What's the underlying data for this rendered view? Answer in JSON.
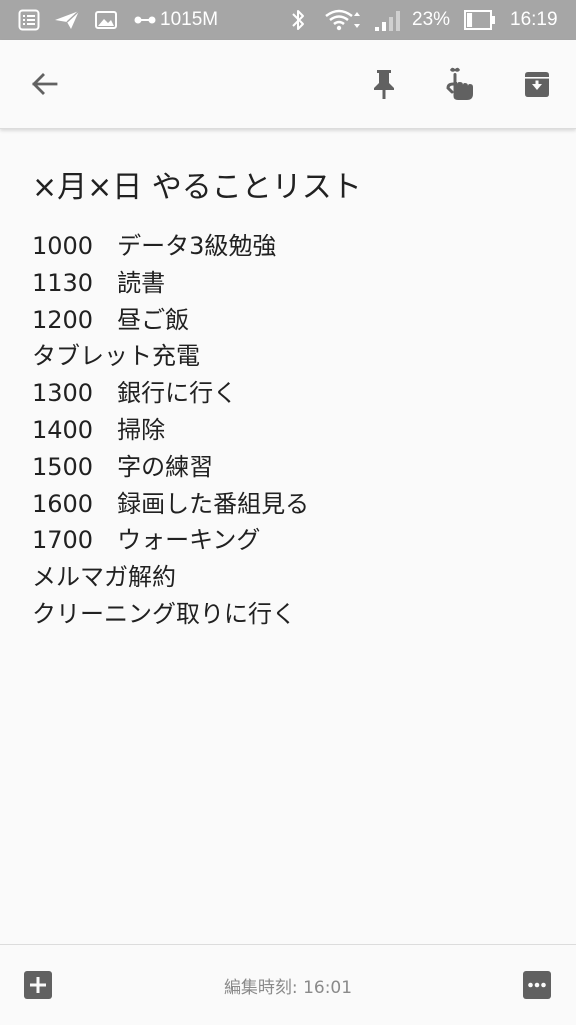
{
  "status_bar": {
    "network_speed": "1015M",
    "battery_percent": "23%",
    "battery_level": 0.23,
    "time": "16:19",
    "icons": [
      "notes-app-icon",
      "send-icon",
      "image-icon",
      "data-link-icon",
      "bluetooth-icon",
      "wifi-icon",
      "signal-icon",
      "battery-icon"
    ]
  },
  "toolbar": {
    "icons": [
      "back-arrow-icon",
      "pin-icon",
      "reminder-icon",
      "archive-icon"
    ]
  },
  "note": {
    "title": "×月×日 やることリスト",
    "lines": [
      "1000　データ3級勉強",
      "1130　読書",
      "1200　昼ご飯",
      "タブレット充電",
      "1300　銀行に行く",
      "1400　掃除",
      "1500　字の練習",
      "1600　録画した番組見る",
      "1700　ウォーキング",
      "メルマガ解約",
      "クリーニング取りに行く"
    ]
  },
  "bottom_bar": {
    "edit_time": "編集時刻: 16:01",
    "icons": [
      "add-box-icon",
      "more-icon"
    ]
  },
  "colors": {
    "status_bar_bg": "#a6a6a6",
    "background": "#fafafa",
    "icon": "#616161",
    "text": "#212121",
    "secondary_text": "#8a8a8a"
  }
}
